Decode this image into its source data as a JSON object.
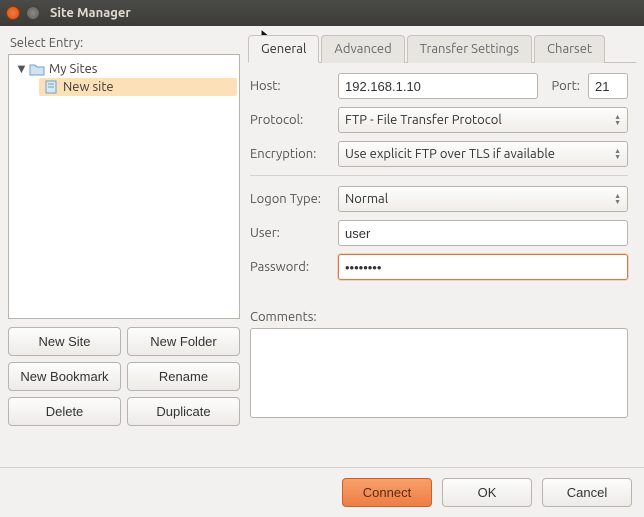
{
  "window": {
    "title": "Site Manager"
  },
  "left": {
    "label": "Select Entry:",
    "root": "My Sites",
    "child": "New site",
    "buttons": {
      "new_site": "New Site",
      "new_folder": "New Folder",
      "new_bookmark": "New Bookmark",
      "rename": "Rename",
      "delete": "Delete",
      "duplicate": "Duplicate"
    }
  },
  "tabs": {
    "general": "General",
    "advanced": "Advanced",
    "transfer": "Transfer Settings",
    "charset": "Charset"
  },
  "form": {
    "host_label": "Host:",
    "host_value": "192.168.1.10",
    "port_label": "Port:",
    "port_value": "21",
    "protocol_label": "Protocol:",
    "protocol_value": "FTP - File Transfer Protocol",
    "encryption_label": "Encryption:",
    "encryption_value": "Use explicit FTP over TLS if available",
    "logon_label": "Logon Type:",
    "logon_value": "Normal",
    "user_label": "User:",
    "user_value": "user",
    "password_label": "Password:",
    "password_value": "••••••••",
    "comments_label": "Comments:",
    "comments_value": ""
  },
  "footer": {
    "connect": "Connect",
    "ok": "OK",
    "cancel": "Cancel"
  }
}
